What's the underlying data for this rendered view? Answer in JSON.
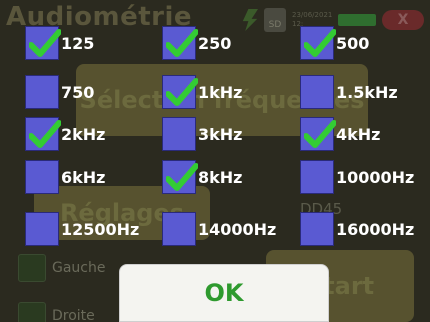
{
  "background": {
    "title": "Audiométrie",
    "status": {
      "date": "23/06/2021",
      "time": "12:",
      "sd_label": "SD",
      "close_label": "X"
    },
    "select_button": "Sélection fréquences",
    "reglages_button": "Réglages",
    "model_label": "DD45",
    "start_button": "Start",
    "gauche_label": "Gauche",
    "droite_label": "Droite"
  },
  "frequencies": [
    {
      "label": "125",
      "checked": true
    },
    {
      "label": "250",
      "checked": true
    },
    {
      "label": "500",
      "checked": true
    },
    {
      "label": "750",
      "checked": false
    },
    {
      "label": "1kHz",
      "checked": true
    },
    {
      "label": "1.5kHz",
      "checked": false
    },
    {
      "label": "2kHz",
      "checked": true
    },
    {
      "label": "3kHz",
      "checked": false
    },
    {
      "label": "4kHz",
      "checked": true
    },
    {
      "label": "6kHz",
      "checked": false
    },
    {
      "label": "8kHz",
      "checked": true
    },
    {
      "label": "10000Hz",
      "checked": false
    },
    {
      "label": "12500Hz",
      "checked": false
    },
    {
      "label": "14000Hz",
      "checked": false
    },
    {
      "label": "16000Hz",
      "checked": false
    }
  ],
  "ok_button": "OK",
  "colors": {
    "checkbox_fill": "#5a5ad2",
    "check_mark": "#33cc33",
    "ok_text": "#2e9a2e"
  }
}
